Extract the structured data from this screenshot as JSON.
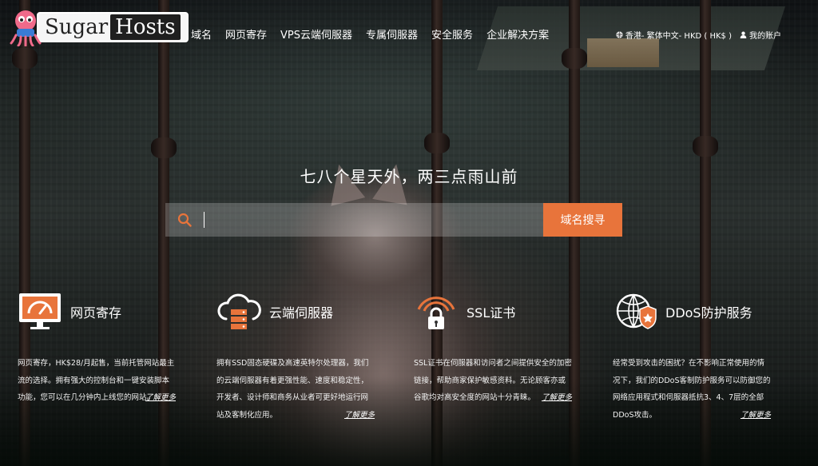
{
  "brand": {
    "name_part1": "Sugar",
    "name_part2": "Hosts"
  },
  "nav": [
    {
      "label": "域名"
    },
    {
      "label": "网页寄存"
    },
    {
      "label": "VPS云端伺服器"
    },
    {
      "label": "专属伺服器"
    },
    {
      "label": "安全服务"
    },
    {
      "label": "企业解决方案"
    }
  ],
  "utility": {
    "region": "香港- 繁体中文- HKD ( HK$ )",
    "account": "我的账户"
  },
  "hero": {
    "title": "七八个星天外，两三点雨山前",
    "search_value": "",
    "search_button": "域名搜寻"
  },
  "features": [
    {
      "title": "网页寄存",
      "icon": "hosting-monitor-icon",
      "desc": "网页寄存，HK$28/月起售，当前托管网站最主流的选择。拥有强大的控制台和一键安装脚本功能，您可以在几分钟内上线您的网站。",
      "more": "了解更多"
    },
    {
      "title": "云端伺服器",
      "icon": "cloud-server-icon",
      "desc": "拥有SSD固态硬碟及高速英特尔处理器，我们的云端伺服器有着更强性能、速度和稳定性，开发者、设计师和商务从业者可更好地运行网站及客制化应用。",
      "more": "了解更多"
    },
    {
      "title": "SSL证书",
      "icon": "ssl-lock-icon",
      "desc": "SSL证书在伺服器和访问者之间提供安全的加密链接，帮助商家保护敏感资料。无论顾客亦或谷歌均对高安全度的网站十分青睐。",
      "more": "了解更多"
    },
    {
      "title": "DDoS防护服务",
      "icon": "ddos-shield-icon",
      "desc": "经常受到攻击的困扰？在不影响正常使用的情况下，我们的DDoS客制防护服务可以防御您的网络应用程式和伺服器抵抗3、4、7层的全部DDoS攻击。",
      "more": "了解更多"
    }
  ],
  "colors": {
    "accent": "#e8743b"
  }
}
